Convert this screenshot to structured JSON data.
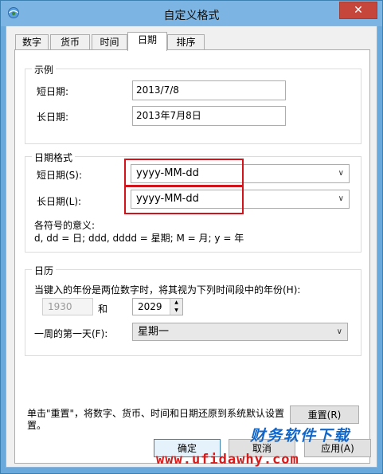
{
  "window": {
    "title": "自定义格式",
    "close_glyph": "✕"
  },
  "tabs": [
    {
      "label": "数字"
    },
    {
      "label": "货币"
    },
    {
      "label": "时间"
    },
    {
      "label": "日期",
      "active": true
    },
    {
      "label": "排序"
    }
  ],
  "example": {
    "group_title": "示例",
    "short_label": "短日期:",
    "short_value": "2013/7/8",
    "long_label": "长日期:",
    "long_value": "2013年7月8日"
  },
  "date_format": {
    "group_title": "日期格式",
    "short_label": "短日期(S):",
    "short_value": "yyyy-MM-dd",
    "long_label": "长日期(L):",
    "long_value": "yyyy-MM-dd",
    "meaning_title": "各符号的意义:",
    "meaning_text": "d, dd = 日;  ddd, dddd = 星期;  M = 月;  y = 年"
  },
  "calendar": {
    "group_title": "日历",
    "two_digit_text": "当键入的年份是两位数字时，将其视为下列时间段中的年份(H):",
    "year_from": "1930",
    "and_label": "和",
    "year_to": "2029",
    "first_day_label": "一周的第一天(F):",
    "first_day_value": "星期一"
  },
  "reset": {
    "text_line1": "单击\"重置\"，将数字、货币、时间和日期还原到系统默认设置",
    "text_line2": "置。",
    "button": "重置(R)"
  },
  "footer": {
    "ok": "确定",
    "cancel": "取消",
    "apply": "应用(A)"
  },
  "watermark": {
    "title": "财务软件下载",
    "url": "www.ufidawhy.com"
  },
  "colors": {
    "highlight_box": "#d1141c",
    "titlebar": "#7cb4e3",
    "close": "#c7463c"
  }
}
